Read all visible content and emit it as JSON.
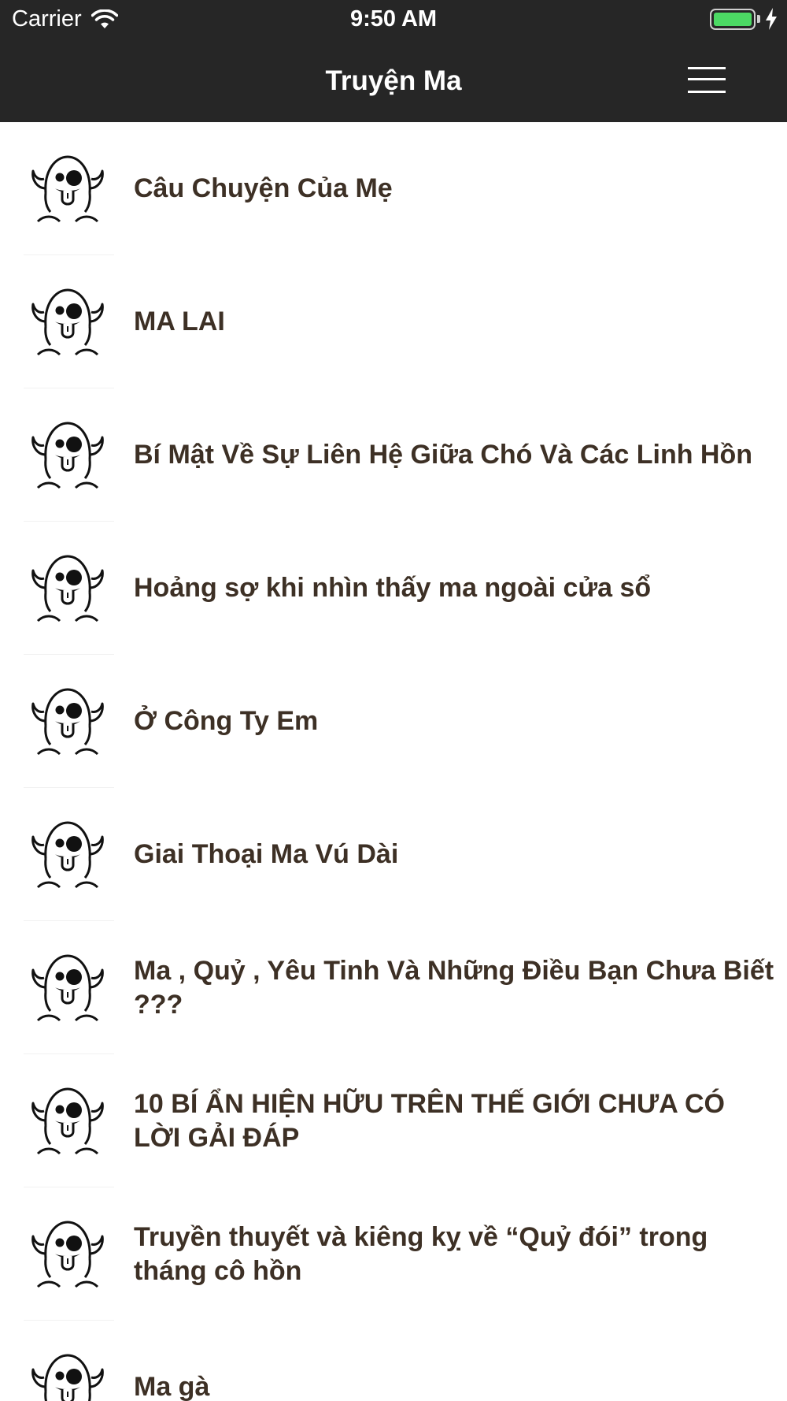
{
  "status_bar": {
    "carrier": "Carrier",
    "time": "9:50 AM",
    "battery_color": "#4cd964"
  },
  "nav": {
    "title": "Truyện Ma",
    "menu_icon": "hamburger-menu-icon"
  },
  "list": {
    "item_icon": "ghost-icon",
    "text_color": "#3d3025",
    "items": [
      {
        "title": "Câu Chuyện Của Mẹ"
      },
      {
        "title": "MA LAI"
      },
      {
        "title": "Bí Mật Về Sự Liên Hệ Giữa Chó Và Các Linh Hồn"
      },
      {
        "title": "Hoảng sợ khi nhìn thấy ma ngoài cửa sổ"
      },
      {
        "title": "Ở Công Ty Em"
      },
      {
        "title": "Giai Thoại Ma Vú Dài"
      },
      {
        "title": "Ma , Quỷ , Yêu Tinh Và Những Điều Bạn Chưa Biết ???"
      },
      {
        "title": "10 BÍ ẨN HIỆN HỮU TRÊN THẾ GIỚI CHƯA CÓ LỜI GẢI ĐÁP"
      },
      {
        "title": "Truyền thuyết và kiêng kỵ về “Quỷ đói” trong tháng cô hồn"
      },
      {
        "title": "Ma gà"
      }
    ]
  }
}
